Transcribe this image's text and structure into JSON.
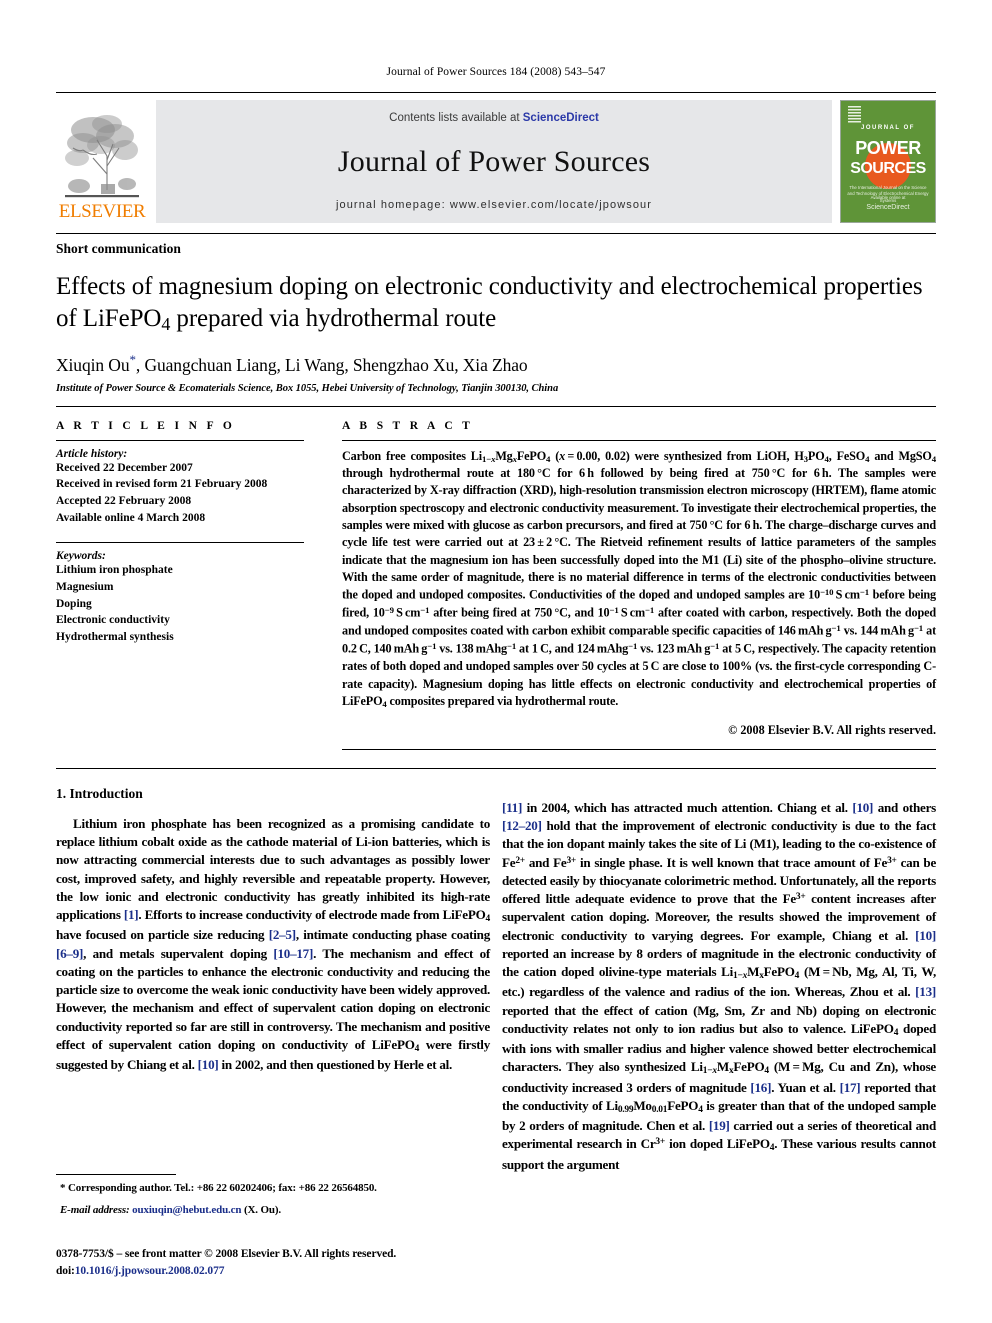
{
  "running_head": "Journal of Power Sources 184 (2008) 543–547",
  "masthead": {
    "publisher_name": "ELSEVIER",
    "contents_prefix": "Contents lists available at ",
    "sciencedirect": "ScienceDirect",
    "journal_name": "Journal of Power Sources",
    "homepage": "journal homepage: www.elsevier.com/locate/jpowsour",
    "cover": {
      "top_label": "JOURNAL OF",
      "word_power": "POWER",
      "word_sources": "SOURCES",
      "subtitle": "The International Journal on the Science and Technology of Electrochemical Energy Systems",
      "footer_small": "Available online at",
      "footer_big": "ScienceDirect"
    },
    "colors": {
      "elsevier_orange": "#f07d00",
      "link_blue": "#2b39a8",
      "band_grey": "#e6e7e9",
      "cover_green": "#5f9438",
      "cover_orange": "#e8591f"
    }
  },
  "article": {
    "doctype": "Short communication",
    "title_line1": "Effects of magnesium doping on electronic conductivity and electrochemical",
    "title_line2_pre": "properties of LiFePO",
    "title_line2_sub": "4",
    "title_line2_post": " prepared via hydrothermal route",
    "authors_pre": "Xiuqin Ou",
    "authors_star": "*",
    "authors_post": ", Guangchuan Liang, Li Wang, Shengzhao Xu, Xia Zhao",
    "affiliation": "Institute of Power Source & Ecomaterials Science, Box 1055, Hebei University of Technology, Tianjin 300130, China"
  },
  "info": {
    "heading": "A R T I C L E   I N F O",
    "history_title": "Article history:",
    "history": [
      "Received 22 December 2007",
      "Received in revised form 21 February 2008",
      "Accepted 22 February 2008",
      "Available online 4 March 2008"
    ],
    "keywords_title": "Keywords:",
    "keywords": [
      "Lithium iron phosphate",
      "Magnesium",
      "Doping",
      "Electronic conductivity",
      "Hydrothermal synthesis"
    ]
  },
  "abstract": {
    "heading": "A B S T R A C T",
    "copyright": "© 2008 Elsevier B.V. All rights reserved."
  },
  "body": {
    "section1_title": "1.  Introduction",
    "footnote_corresponding": "* Corresponding author. Tel.: +86 22 60202406; fax: +86 22 26564850.",
    "footnote_email_label": "E-mail address:",
    "footnote_email": "ouxiuqin@hebut.edu.cn",
    "footnote_email_suffix": " (X. Ou).",
    "issn_line": "0378-7753/$ – see front matter © 2008 Elsevier B.V. All rights reserved.",
    "doi_label": "doi:",
    "doi_value": "10.1016/j.jpowsour.2008.02.077"
  }
}
